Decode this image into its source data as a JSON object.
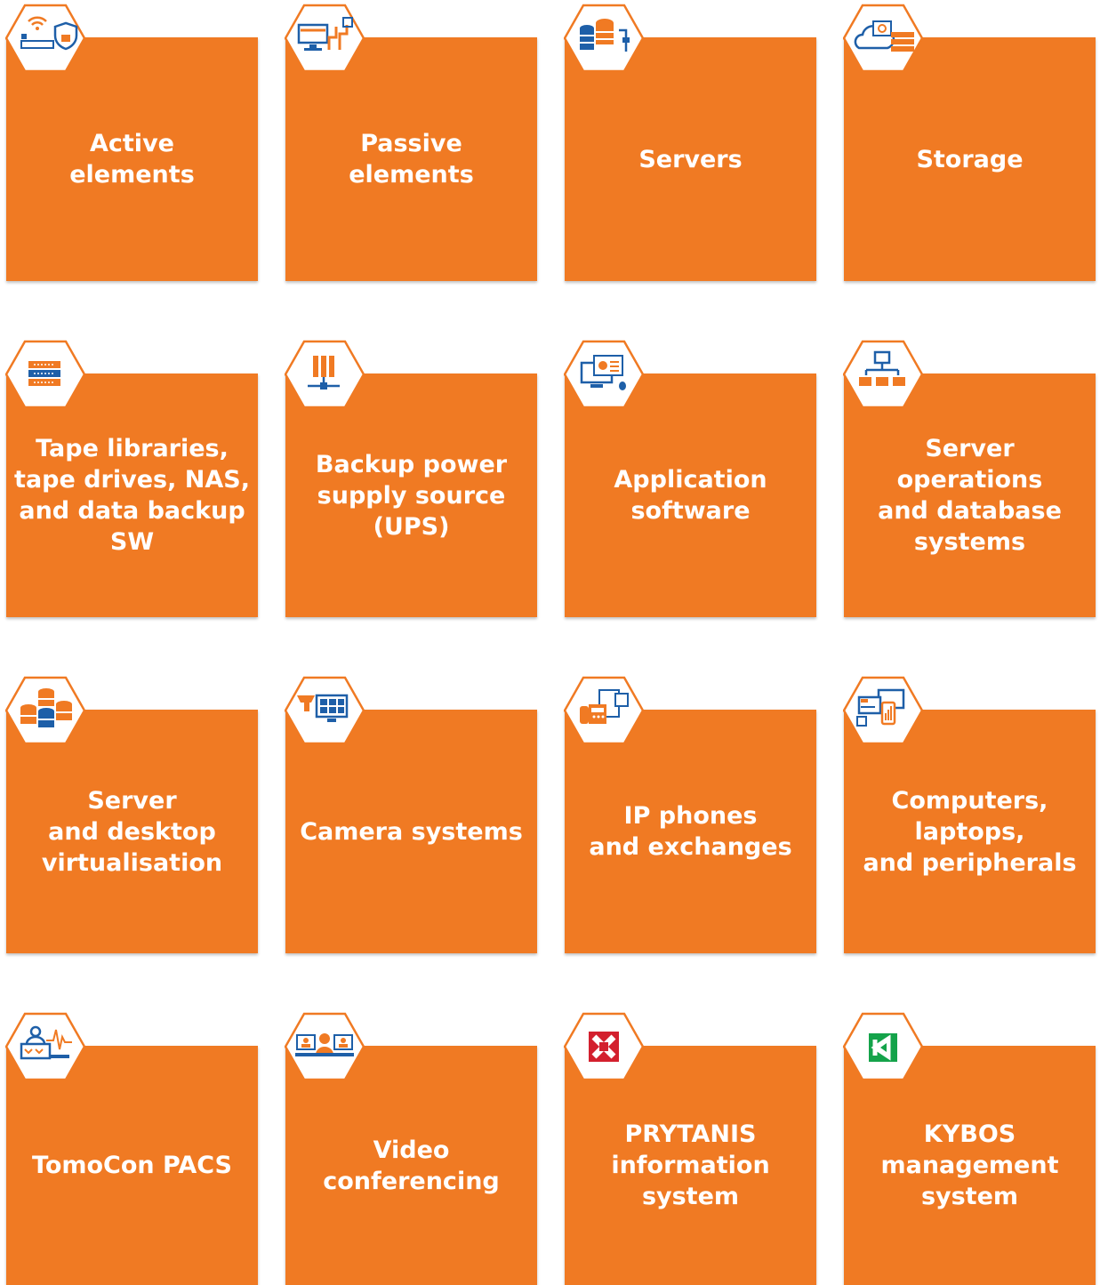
{
  "colors": {
    "tile": "#F07A23",
    "hex_border": "#F07A23",
    "icon_primary": "#1E5FA8",
    "icon_accent": "#F07A23",
    "prytanis_red": "#D3202E",
    "kybos_green": "#14A34A"
  },
  "tiles": [
    {
      "label": "Active\nelements",
      "icon": "wifi-router-shield-icon"
    },
    {
      "label": "Passive\nelements",
      "icon": "patch-panel-cable-icon"
    },
    {
      "label": "Servers",
      "icon": "server-database-icon"
    },
    {
      "label": "Storage",
      "icon": "cloud-storage-icon"
    },
    {
      "label": "Tape libraries,\ntape drives, NAS,\nand data backup\nSW",
      "icon": "rack-units-icon"
    },
    {
      "label": "Backup power\nsupply source\n(UPS)",
      "icon": "ups-battery-icon"
    },
    {
      "label": "Application\nsoftware",
      "icon": "monitor-app-icon"
    },
    {
      "label": "Server\noperations\nand database\nsystems",
      "icon": "network-hierarchy-icon"
    },
    {
      "label": "Server\nand desktop\nvirtualisation",
      "icon": "stacked-disks-icon"
    },
    {
      "label": "Camera systems",
      "icon": "cctv-monitor-icon"
    },
    {
      "label": "IP phones\nand exchanges",
      "icon": "ip-phone-icon"
    },
    {
      "label": "Computers,\nlaptops,\nand peripherals",
      "icon": "computer-devices-icon"
    },
    {
      "label": "TomoCon PACS",
      "icon": "medical-imaging-icon"
    },
    {
      "label": "Video\nconferencing",
      "icon": "video-conference-icon"
    },
    {
      "label": "PRYTANIS\ninformation\nsystem",
      "icon": "prytanis-logo-icon"
    },
    {
      "label": "KYBOS\nmanagement\nsystem",
      "icon": "kybos-logo-icon"
    }
  ]
}
